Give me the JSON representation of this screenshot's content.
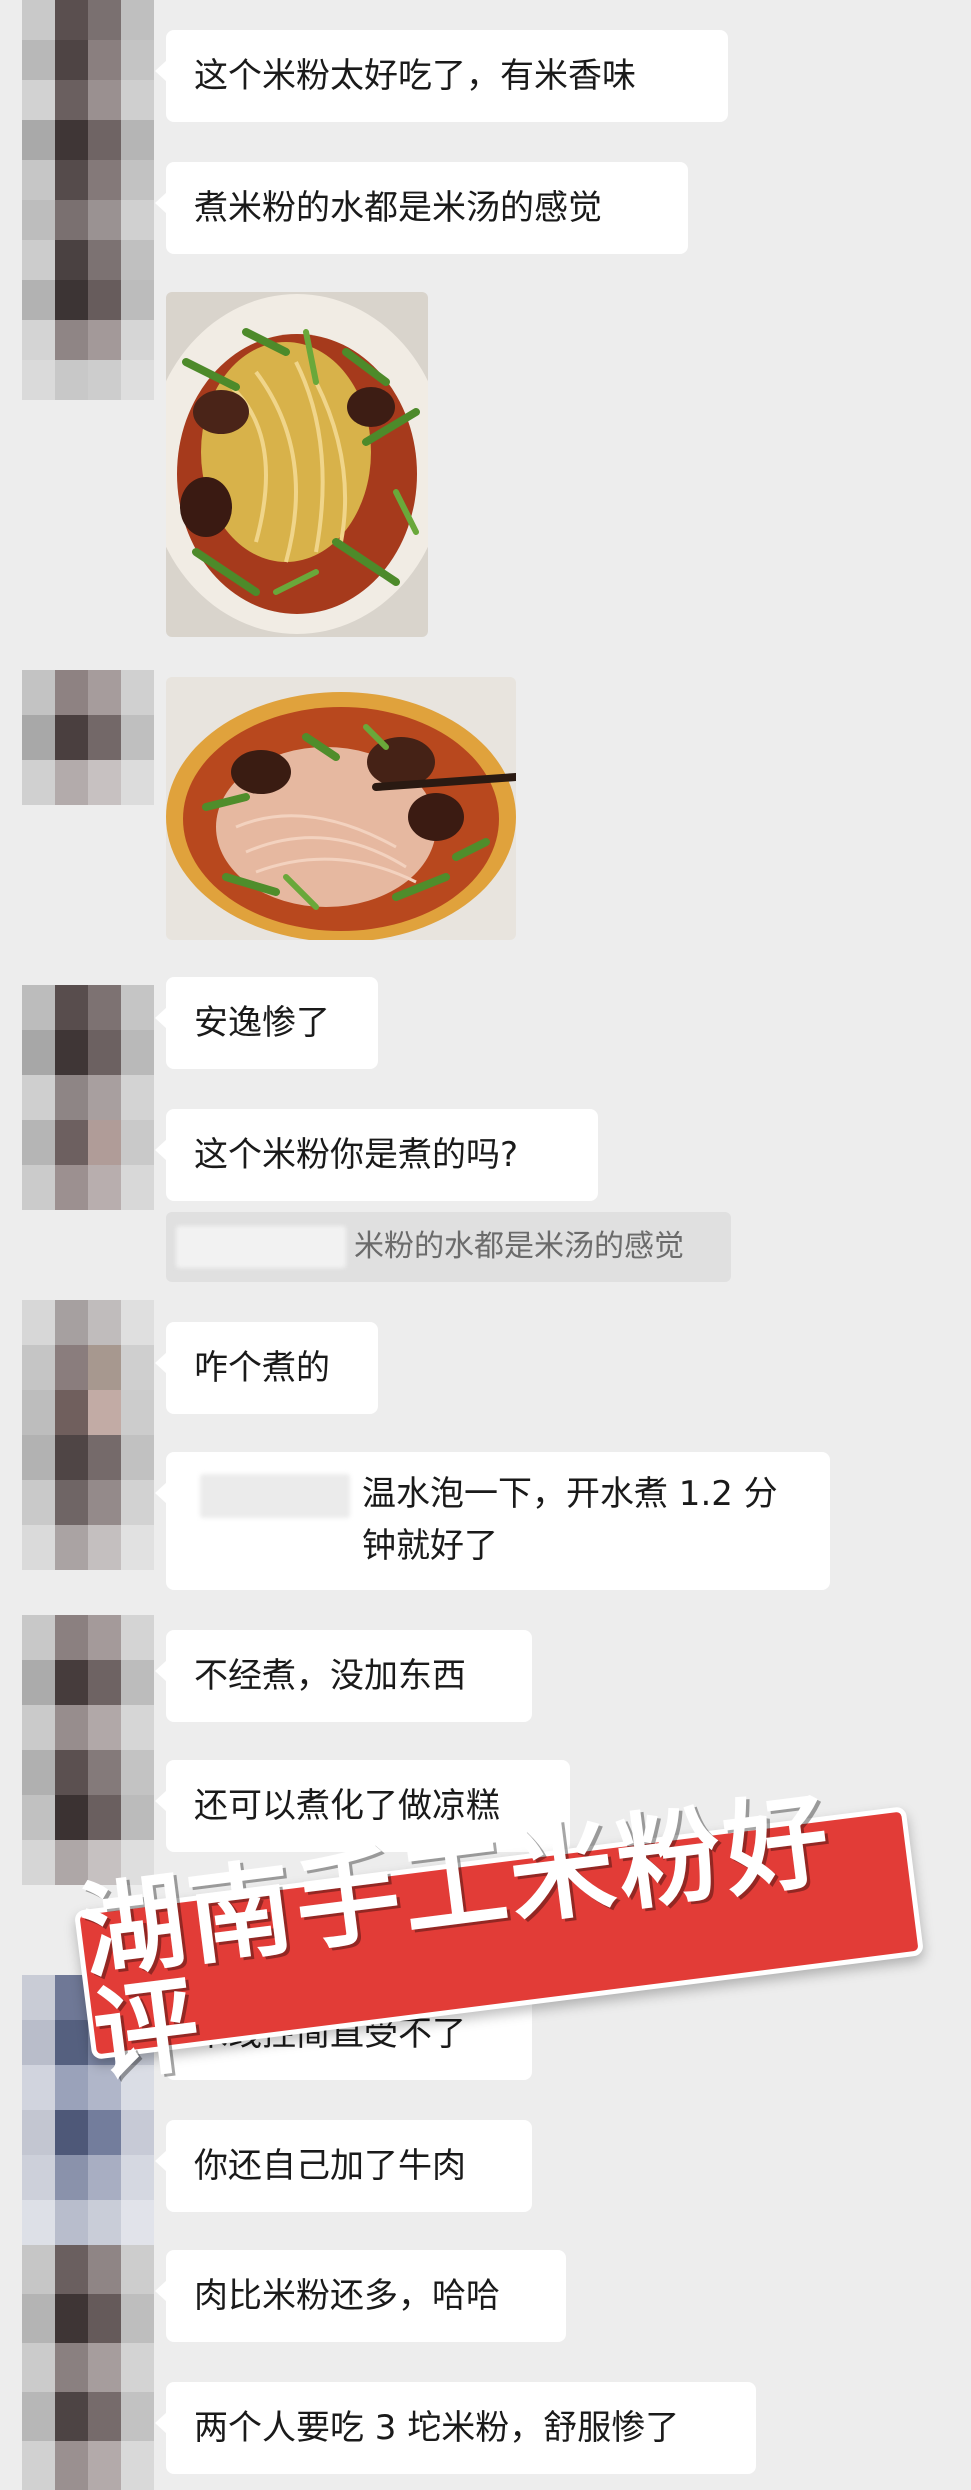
{
  "messages": [
    {
      "kind": "text",
      "text": "这个米粉太好吃了，有米香味"
    },
    {
      "kind": "text",
      "text": "煮米粉的水都是米汤的感觉"
    },
    {
      "kind": "image",
      "alt_name": "rice-noodle-photo-1"
    },
    {
      "kind": "image",
      "alt_name": "rice-noodle-photo-2"
    },
    {
      "kind": "text",
      "text": "安逸惨了"
    },
    {
      "kind": "text",
      "text": "这个米粉你是煮的吗?"
    },
    {
      "kind": "quote",
      "text": "米粉的水都是米汤的感觉"
    },
    {
      "kind": "text",
      "text": "咋个煮的"
    },
    {
      "kind": "text",
      "text": "温水泡一下，开水煮 1.2 分钟就好了"
    },
    {
      "kind": "text",
      "text": "不经煮，没加东西"
    },
    {
      "kind": "text",
      "text": "还可以煮化了做凉糕"
    },
    {
      "kind": "text",
      "text": "米线控简直受不了"
    },
    {
      "kind": "text",
      "text": "你还自己加了牛肉"
    },
    {
      "kind": "text",
      "text": "肉比米粉还多，哈哈"
    },
    {
      "kind": "text",
      "text": "两个人要吃 3 坨米粉，舒服惨了"
    }
  ],
  "banner": {
    "text": "湖南手工米粉好评"
  },
  "colors": {
    "background": "#ededed",
    "bubble": "#ffffff",
    "banner_red": "#e23c37",
    "banner_text": "#ffffff"
  }
}
